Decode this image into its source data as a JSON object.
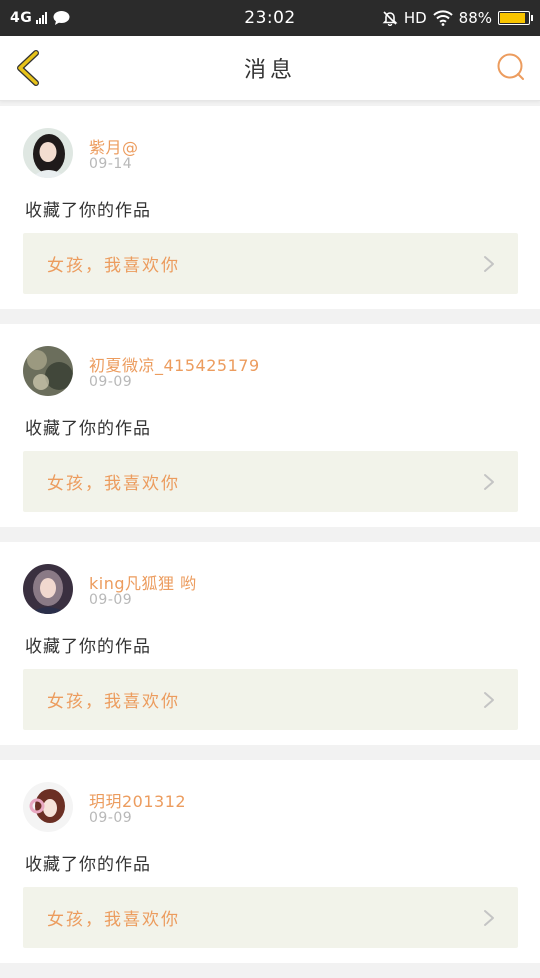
{
  "status_bar": {
    "network": "4G",
    "time": "23:02",
    "hd": "HD",
    "battery": "88%",
    "battery_level": 0.88,
    "icons": [
      "signal-icon",
      "message-icon",
      "mute-icon",
      "wifi-icon",
      "battery-icon"
    ]
  },
  "header": {
    "title": "消息",
    "back_icon": "chevron-left-icon",
    "search_icon": "search-icon"
  },
  "colors": {
    "accent": "#ec9c5e",
    "back_icon": "#e6c21a",
    "card_bg": "#f2f3ea",
    "status_bar": "#2b2b2b",
    "battery_fill": "#f9c500"
  },
  "messages": [
    {
      "username": "紫月@",
      "date": "09-14",
      "action": "收藏了你的作品",
      "work_title": "女孩，我喜欢你"
    },
    {
      "username": "初夏微凉_415425179",
      "date": "09-09",
      "action": "收藏了你的作品",
      "work_title": "女孩，我喜欢你"
    },
    {
      "username": "king凡狐狸 哟",
      "date": "09-09",
      "action": "收藏了你的作品",
      "work_title": "女孩，我喜欢你"
    },
    {
      "username": "玥玥201312",
      "date": "09-09",
      "action": "收藏了你的作品",
      "work_title": "女孩，我喜欢你"
    }
  ]
}
